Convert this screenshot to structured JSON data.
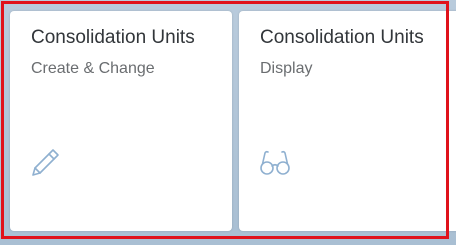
{
  "tiles": [
    {
      "title": "Consolidation Units",
      "subtitle": "Create & Change",
      "icon": "pencil-icon"
    },
    {
      "title": "Consolidation Units",
      "subtitle": "Display",
      "icon": "glasses-icon"
    }
  ],
  "colors": {
    "highlight": "#e0121b",
    "icon": "#8fb0d0",
    "background": "#b3c6d8"
  }
}
